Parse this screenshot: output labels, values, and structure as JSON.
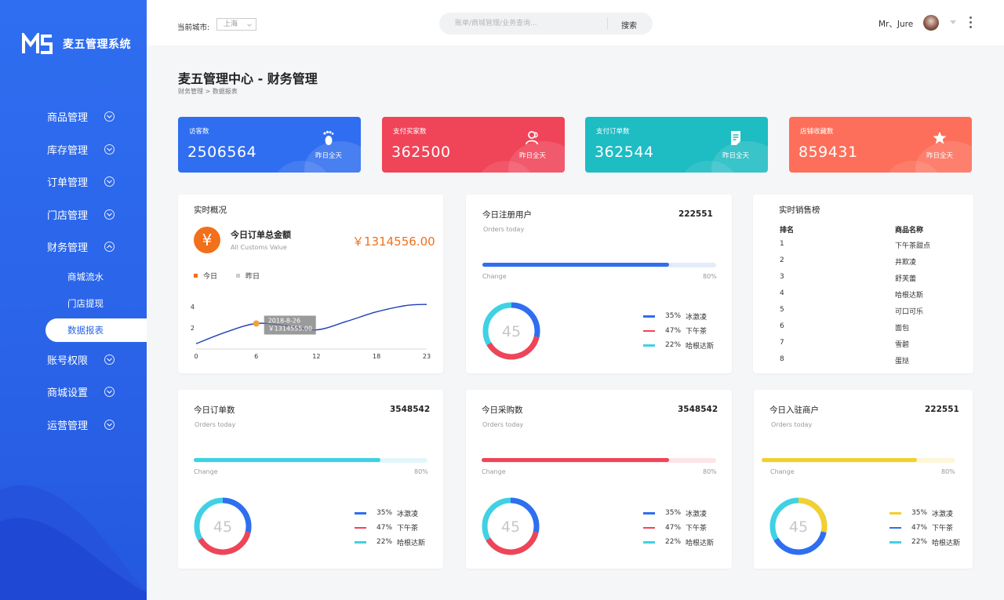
{
  "colors": {
    "blue": "#2f6ef0",
    "red": "#f04458",
    "teal": "#1ebcc3",
    "coral": "#fd6f5a",
    "orange": "#f2701b",
    "cyan": "#3fd1e4",
    "yellow": "#f3cf2f"
  },
  "sidebar": {
    "logo_mark": "MS",
    "app_name": "麦五管理系统",
    "menu": [
      {
        "label": "商品管理",
        "icon": "chevron-down-icon"
      },
      {
        "label": "库存管理",
        "icon": "chevron-down-icon"
      },
      {
        "label": "订单管理",
        "icon": "chevron-down-icon"
      },
      {
        "label": "门店管理",
        "icon": "chevron-down-icon"
      },
      {
        "label": "财务管理",
        "icon": "chevron-up-icon",
        "children": [
          {
            "label": "商城流水"
          },
          {
            "label": "门店提现"
          },
          {
            "label": "数据报表",
            "active": true
          }
        ]
      },
      {
        "label": "账号权限",
        "icon": "chevron-down-icon"
      },
      {
        "label": "商城设置",
        "icon": "chevron-down-icon"
      },
      {
        "label": "运营管理",
        "icon": "chevron-down-icon"
      }
    ]
  },
  "topbar": {
    "city_label": "当前城市:",
    "city_value": "上海",
    "search_placeholder": "账单/商城管理/业务查询...",
    "search_button": "搜索",
    "user_name": "Mr、Jure"
  },
  "page": {
    "title": "麦五管理中心 - 财务管理",
    "breadcrumb": "财务管理 > 数据报表"
  },
  "stats": [
    {
      "label": "访客数",
      "value": "2506564",
      "sub": "昨日全天",
      "icon": "footprint-icon"
    },
    {
      "label": "支付买家数",
      "value": "362500",
      "sub": "昨日全天",
      "icon": "users-icon"
    },
    {
      "label": "支付订单数",
      "value": "362544",
      "sub": "昨日全天",
      "icon": "document-icon"
    },
    {
      "label": "店铺收藏数",
      "value": "859431",
      "sub": "昨日全天",
      "icon": "star-icon"
    }
  ],
  "overview": {
    "title": "实时概况",
    "metric_title": "今日订单总金额",
    "metric_sub": "All Customs Value",
    "amount": "￥1314556.00",
    "legend": [
      "今日",
      "昨日"
    ],
    "tooltip_date": "2018-8-26",
    "tooltip_value": "￥1314555.00"
  },
  "chart_data": {
    "type": "line",
    "x": [
      0,
      3,
      6,
      9,
      12,
      15,
      18,
      21,
      23
    ],
    "x_ticks": [
      "0",
      "6",
      "12",
      "18",
      "23"
    ],
    "y_ticks": [
      "2",
      "4"
    ],
    "ylim": [
      0,
      4.8
    ],
    "xlim": [
      0,
      23
    ],
    "series": [
      {
        "name": "今日",
        "values": [
          0.5,
          1.6,
          2.4,
          2.2,
          1.8,
          2.6,
          3.5,
          4.1,
          4.2
        ]
      }
    ],
    "highlight_x": 6
  },
  "panels": {
    "registered": {
      "title": "今日注册用户",
      "value": "222551",
      "sub": "Orders today",
      "change_label": "Change",
      "pct_label": "80%",
      "progress": 0.8,
      "donut_center": "45",
      "legend": [
        {
          "pct": "35%",
          "label": "冰激凌"
        },
        {
          "pct": "47%",
          "label": "下午茶"
        },
        {
          "pct": "22%",
          "label": "哈根达斯"
        }
      ]
    },
    "ranking": {
      "title": "实时销售榜",
      "headers": [
        "排名",
        "商品名称"
      ],
      "rows": [
        {
          "rank": "1",
          "name": "下午茶甜点"
        },
        {
          "rank": "2",
          "name": "井欺凌"
        },
        {
          "rank": "3",
          "name": "舒芙蕾"
        },
        {
          "rank": "4",
          "name": "哈根达斯"
        },
        {
          "rank": "5",
          "name": "可口可乐"
        },
        {
          "rank": "6",
          "name": "面包"
        },
        {
          "rank": "7",
          "name": "雪碧"
        },
        {
          "rank": "8",
          "name": "蛋挞"
        }
      ]
    },
    "orders": {
      "title": "今日订单数",
      "value": "3548542",
      "sub": "Orders today",
      "change_label": "Change",
      "pct_label": "80%",
      "progress": 0.8,
      "donut_center": "45",
      "legend": [
        {
          "pct": "35%",
          "label": "冰激凌"
        },
        {
          "pct": "47%",
          "label": "下午茶"
        },
        {
          "pct": "22%",
          "label": "哈根达斯"
        }
      ]
    },
    "purchases": {
      "title": "今日采购数",
      "value": "3548542",
      "sub": "Orders today",
      "change_label": "Change",
      "pct_label": "80%",
      "progress": 0.8,
      "donut_center": "45",
      "legend": [
        {
          "pct": "35%",
          "label": "冰激凌"
        },
        {
          "pct": "47%",
          "label": "下午茶"
        },
        {
          "pct": "22%",
          "label": "哈根达斯"
        }
      ]
    },
    "merchants": {
      "title": "今日入驻商户",
      "value": "222551",
      "sub": "Orders today",
      "change_label": "Change",
      "pct_label": "80%",
      "progress": 0.8,
      "donut_center": "45",
      "legend": [
        {
          "pct": "35%",
          "label": "冰激凌"
        },
        {
          "pct": "47%",
          "label": "下午茶"
        },
        {
          "pct": "22%",
          "label": "哈根达斯"
        }
      ]
    }
  }
}
